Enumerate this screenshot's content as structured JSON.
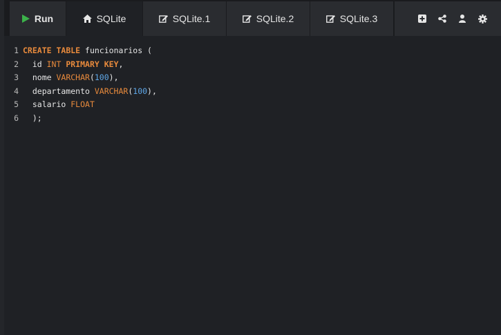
{
  "toolbar": {
    "run_label": "Run",
    "tabs": [
      {
        "label": "SQLite",
        "icon": "home-icon",
        "active": true
      },
      {
        "label": "SQLite.1",
        "icon": "edit-icon",
        "active": false
      },
      {
        "label": "SQLite.2",
        "icon": "edit-icon",
        "active": false
      },
      {
        "label": "SQLite.3",
        "icon": "edit-icon",
        "active": false
      }
    ],
    "tools": [
      "add-icon",
      "share-icon",
      "user-icon",
      "gear-icon"
    ]
  },
  "editor": {
    "lines": [
      {
        "n": "1",
        "tokens": [
          [
            "kw",
            "CREATE"
          ],
          [
            "id",
            " "
          ],
          [
            "kw",
            "TABLE"
          ],
          [
            "id",
            " funcionarios "
          ],
          [
            "pn",
            "("
          ]
        ]
      },
      {
        "n": "2",
        "tokens": [
          [
            "id",
            "  id "
          ],
          [
            "ty",
            "INT"
          ],
          [
            "id",
            " "
          ],
          [
            "kw",
            "PRIMARY KEY"
          ],
          [
            "pn",
            ","
          ]
        ]
      },
      {
        "n": "3",
        "tokens": [
          [
            "id",
            "  nome "
          ],
          [
            "ty",
            "VARCHAR"
          ],
          [
            "pn",
            "("
          ],
          [
            "num",
            "100"
          ],
          [
            "pn",
            "),"
          ]
        ]
      },
      {
        "n": "4",
        "tokens": [
          [
            "id",
            "  departamento "
          ],
          [
            "ty",
            "VARCHAR"
          ],
          [
            "pn",
            "("
          ],
          [
            "num",
            "100"
          ],
          [
            "pn",
            "),"
          ]
        ]
      },
      {
        "n": "5",
        "tokens": [
          [
            "id",
            "  salario "
          ],
          [
            "ty",
            "FLOAT"
          ]
        ]
      },
      {
        "n": "6",
        "tokens": [
          [
            "pn",
            "  );"
          ]
        ]
      }
    ]
  },
  "colors": {
    "run_icon": "#3cb24a",
    "keyword": "#e88a3c",
    "number": "#5fa8e8"
  }
}
